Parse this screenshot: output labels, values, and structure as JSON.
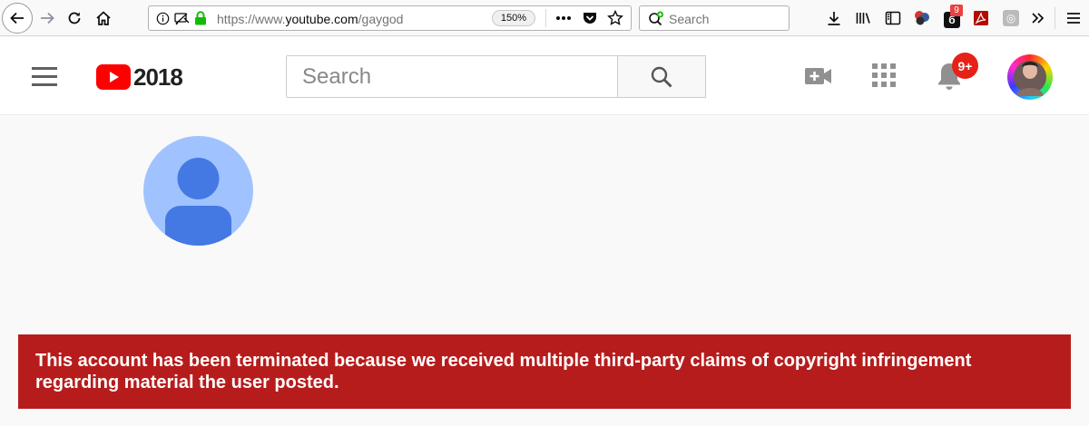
{
  "browser": {
    "url_prefix": "https://www.",
    "url_domain": "youtube.com",
    "url_path": "/gaygod",
    "zoom": "150%",
    "search_placeholder": "Search",
    "extension_badge": "9"
  },
  "youtube": {
    "logo_year": "2018",
    "search_placeholder": "Search",
    "notification_count": "9+"
  },
  "channel": {
    "termination_message": "This account has been terminated because we received multiple third-party claims of copyright infringement regarding material the user posted."
  },
  "colors": {
    "youtube_red": "#ff0000",
    "banner_red": "#b71c1c",
    "avatar_bg": "#a0c3ff",
    "avatar_fg": "#4479e4"
  }
}
